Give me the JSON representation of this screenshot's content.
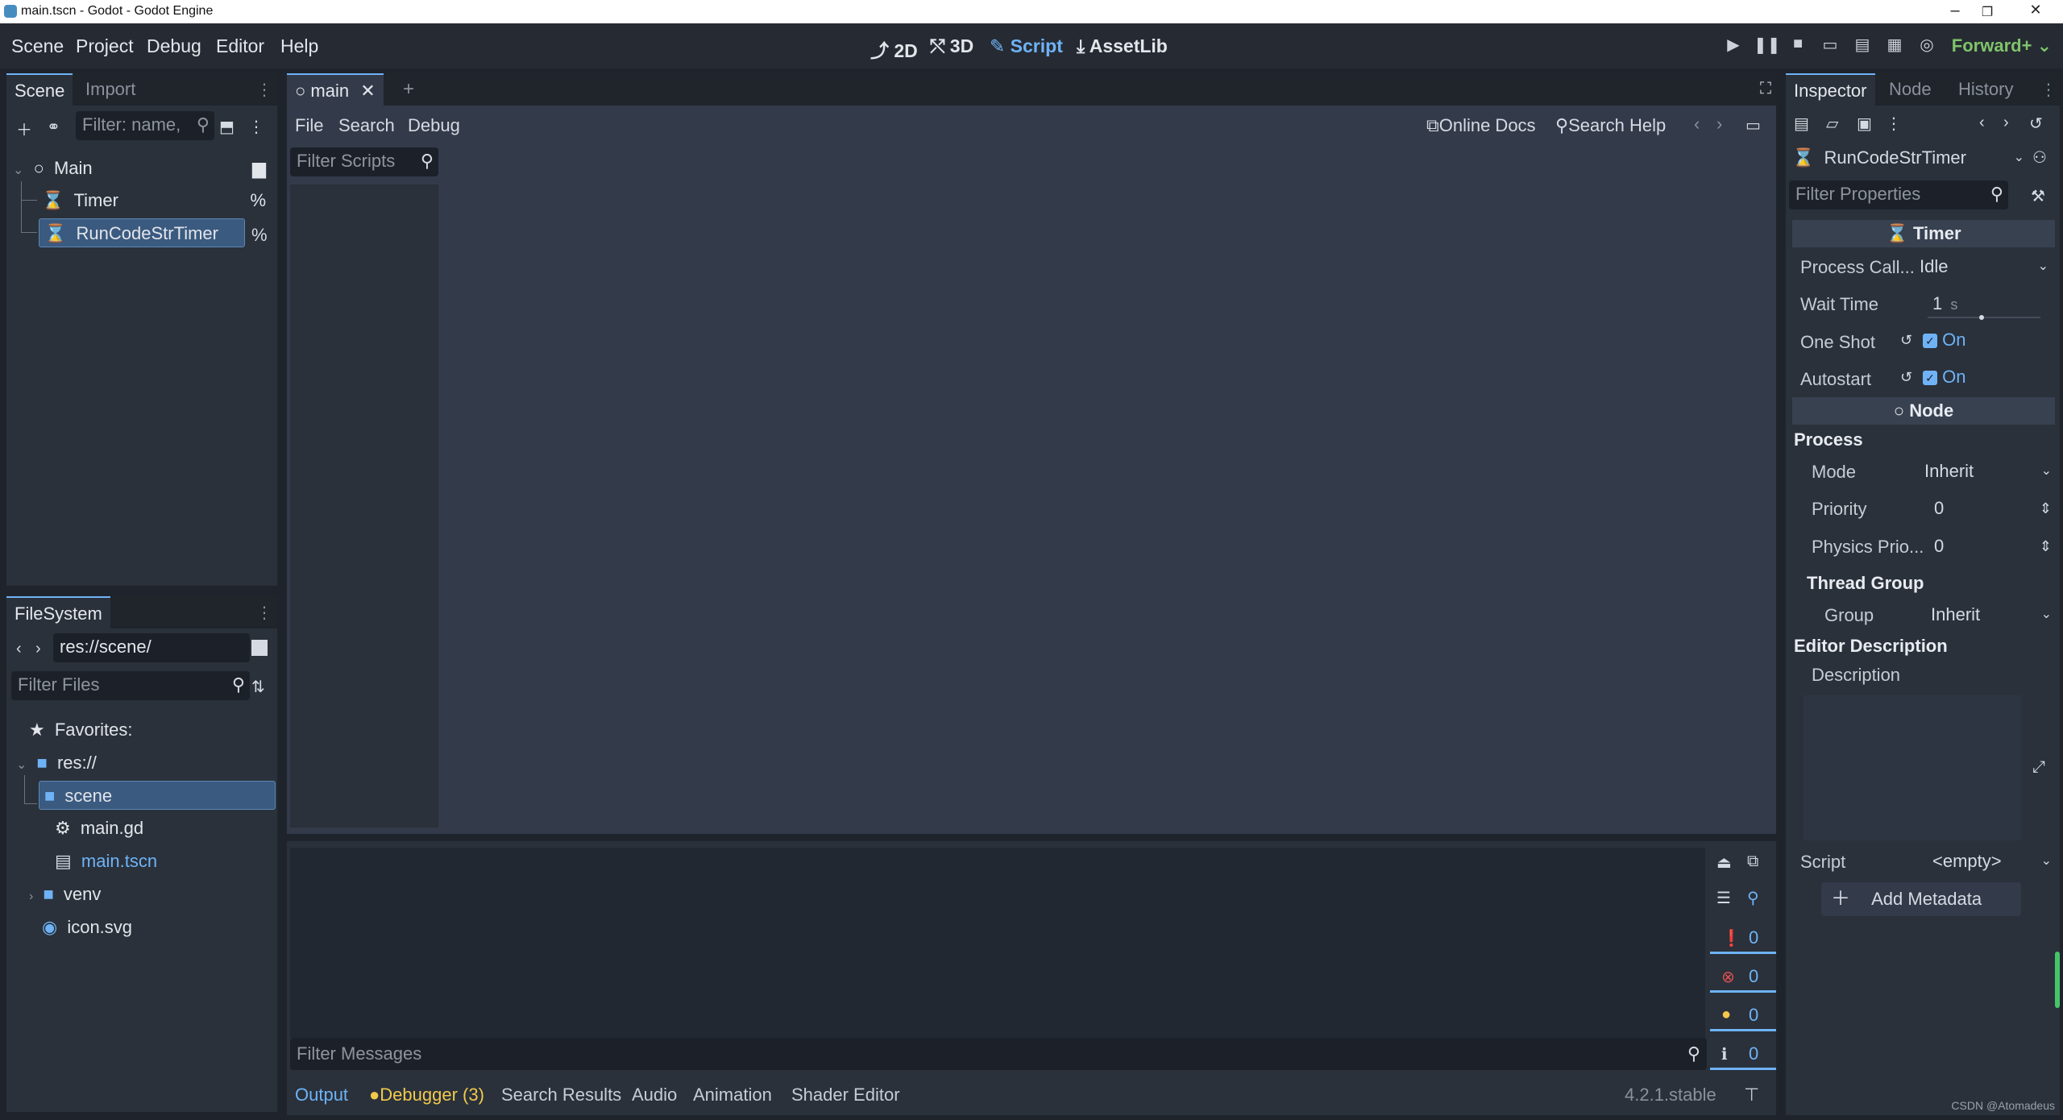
{
  "window": {
    "title": "main.tscn - Godot - Godot Engine",
    "minimize": "–",
    "restore": "❐",
    "close": "✕"
  },
  "menu": [
    "Scene",
    "Project",
    "Debug",
    "Editor",
    "Help"
  ],
  "workspaces": {
    "twod": "2D",
    "threed": "3D",
    "script": "Script",
    "assetlib": "AssetLib"
  },
  "renderer": "Forward+",
  "scene_dock": {
    "tabs": [
      "Scene",
      "Import"
    ],
    "filter_placeholder": "Filter: name,",
    "nodes": [
      {
        "label": "Main",
        "icon": "node-circle-icon"
      },
      {
        "label": "Timer",
        "icon": "hourglass-icon"
      },
      {
        "label": "RunCodeStrTimer",
        "icon": "hourglass-icon"
      }
    ],
    "unique_marker": "%"
  },
  "filesystem": {
    "tab": "FileSystem",
    "path": "res://scene/",
    "filter_placeholder": "Filter Files",
    "items": [
      {
        "label": "Favorites:"
      },
      {
        "label": "res://"
      },
      {
        "label": "scene"
      },
      {
        "label": "main.gd"
      },
      {
        "label": "main.tscn"
      },
      {
        "label": "venv"
      },
      {
        "label": "icon.svg"
      }
    ]
  },
  "editor": {
    "tab_label": "main",
    "add_tab": "+",
    "script_menu": [
      "File",
      "Search",
      "Debug"
    ],
    "online_docs": "Online Docs",
    "search_help": "Search Help",
    "filter_scripts": "Filter Scripts"
  },
  "output": {
    "filter_messages": "Filter Messages",
    "counters": [
      "0",
      "0",
      "0",
      "0"
    ],
    "tabs": [
      "Output",
      "Debugger (3)",
      "Search Results",
      "Audio",
      "Animation",
      "Shader Editor"
    ],
    "version": "4.2.1.stable"
  },
  "inspector": {
    "tabs": [
      "Inspector",
      "Node",
      "History"
    ],
    "object_name": "RunCodeStrTimer",
    "filter_properties": "Filter Properties",
    "timer_section": "Timer",
    "process_callback": {
      "label": "Process Call...",
      "value": "Idle"
    },
    "wait_time": {
      "label": "Wait Time",
      "value": "1",
      "unit": "s"
    },
    "one_shot": {
      "label": "One Shot",
      "value": "On"
    },
    "autostart": {
      "label": "Autostart",
      "value": "On"
    },
    "node_section": "Node",
    "process_group": "Process",
    "mode": {
      "label": "Mode",
      "value": "Inherit"
    },
    "priority": {
      "label": "Priority",
      "value": "0"
    },
    "physics_priority": {
      "label": "Physics Prio...",
      "value": "0"
    },
    "thread_group": "Thread Group",
    "group": {
      "label": "Group",
      "value": "Inherit"
    },
    "editor_description": "Editor Description",
    "description": "Description",
    "script": {
      "label": "Script",
      "value": "<empty>"
    },
    "add_metadata": "Add Metadata"
  },
  "watermark": "CSDN @Atomadeus"
}
